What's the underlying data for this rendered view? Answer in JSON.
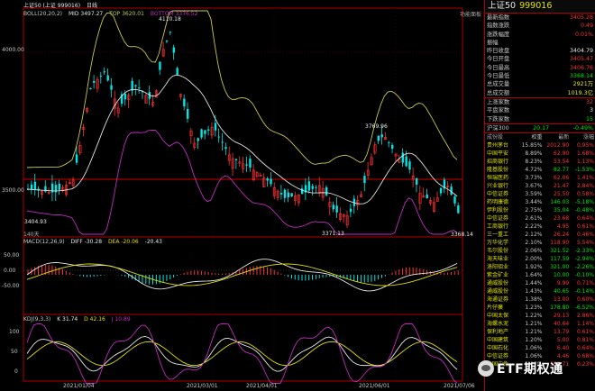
{
  "top_panel": {
    "title": "上证50 (上证 999016)",
    "period": "日线",
    "indicator_name": "BOLL(20,20,2)",
    "mid": "MID 3497.27",
    "top": "TOP 3620.01",
    "bottom": "BOTTOM 3376.52",
    "corner_label": "功能面板"
  },
  "price_labels": {
    "high1": "4110.18",
    "high2": "3769.96",
    "low1": "3404.93",
    "low2": "3371.13",
    "low3": "3368.14",
    "axis_4000": "4000.00",
    "axis_3500": "3500.00",
    "bars_label": "140天"
  },
  "macd_panel": {
    "name": "MACD(12,26,9)",
    "diff": "DIFF -30.28",
    "dea": "DEA -20.06",
    "macd": "-20.43",
    "axis_50": "50.00",
    "axis_0": "0.00",
    "axis_m50": "-50.00"
  },
  "kdj_panel": {
    "name": "KDJ(9,3,3)",
    "k": "K 31.74",
    "d": "D 42.16",
    "j": "J 10.89",
    "axis_100": "100",
    "axis_50": "50",
    "axis_0": "0"
  },
  "dates": [
    "2021/01/04",
    "2021/03/01",
    "2021/04/01",
    "2021/06/01",
    "2021/07/06"
  ],
  "quote": {
    "name": "上证50",
    "code": "999016",
    "rows": [
      {
        "label": "最新指数",
        "value": "3405.28",
        "color": "red"
      },
      {
        "label": "指数涨跌",
        "value": "0.49",
        "color": "red"
      },
      {
        "label": "涨跌幅度",
        "value": "0.01%",
        "color": "red"
      },
      {
        "label": "振幅",
        "value": "",
        "color": "white"
      },
      {
        "label": "昨日收盘",
        "value": "3404.79",
        "color": "white"
      },
      {
        "label": "今日开盘",
        "value": "3405.47",
        "color": "red"
      },
      {
        "label": "今日最高",
        "value": "3406.76",
        "color": "red"
      },
      {
        "label": "今日最低",
        "value": "3368.14",
        "color": "green"
      },
      {
        "label": "总成交量",
        "value": "2921万",
        "color": "yellow"
      },
      {
        "label": "总成交额",
        "value": "1019.3亿",
        "color": "yellow"
      },
      {
        "label": "上涨家数",
        "value": "32",
        "color": "red"
      },
      {
        "label": "平盘家数",
        "value": "3",
        "color": "white"
      },
      {
        "label": "下跌家数",
        "value": "15",
        "color": "green"
      },
      {
        "label": "沪深300",
        "value": "20.17",
        "value2": "-0.49%",
        "color": "green"
      }
    ]
  },
  "components": {
    "headers": [
      "成份股",
      "权重",
      "最新",
      "涨幅"
    ],
    "rows": [
      {
        "name": "贵州茅台",
        "w": "15.85%",
        "p": "2012.90",
        "c": "0.95%",
        "dir": "up"
      },
      {
        "name": "中国平安",
        "w": "8.89%",
        "p": "62.90",
        "c": "1.68%",
        "dir": "up"
      },
      {
        "name": "招商银行",
        "w": "8.23%",
        "p": "53.54",
        "c": "1.13%",
        "dir": "up"
      },
      {
        "name": "隆基股份",
        "w": "4.72%",
        "p": "82.77",
        "c": "-1.53%",
        "dir": "down"
      },
      {
        "name": "恒瑞医药",
        "w": "3.73%",
        "p": "62.06",
        "c": "1.41%",
        "dir": "up"
      },
      {
        "name": "兴业银行",
        "w": "3.67%",
        "p": "21.47",
        "c": "2.84%",
        "dir": "up"
      },
      {
        "name": "中信证券",
        "w": "3.59%",
        "p": "25.50",
        "c": "0.58%",
        "dir": "up"
      },
      {
        "name": "药明康德",
        "w": "3.44%",
        "p": "146.03",
        "c": "-5.18%",
        "dir": "down"
      },
      {
        "name": "伊利股份",
        "w": "2.75%",
        "p": "35.04",
        "c": "-0.48%",
        "dir": "down"
      },
      {
        "name": "中信证券",
        "w": "2.61%",
        "p": "23.68",
        "c": "0.64%",
        "dir": "up"
      },
      {
        "name": "工商银行",
        "w": "2.22%",
        "p": "4.95",
        "c": "0.61%",
        "dir": "up"
      },
      {
        "name": "三一重工",
        "w": "2.12%",
        "p": "26.24",
        "c": "0.46%",
        "dir": "up"
      },
      {
        "name": "万华化学",
        "w": "2.10%",
        "p": "118.90",
        "c": "5.54%",
        "dir": "up"
      },
      {
        "name": "韦尔股份",
        "w": "2.06%",
        "p": "321.52",
        "c": "-2.33%",
        "dir": "down"
      },
      {
        "name": "海天味业",
        "w": "2.00%",
        "p": "117.59",
        "c": "-2.94%",
        "dir": "down"
      },
      {
        "name": "洛阳钼业",
        "w": "1.92%",
        "p": "321.00",
        "c": "-2.26%",
        "dir": "down"
      },
      {
        "name": "紫金矿业",
        "w": "1.64%",
        "p": "10.00",
        "c": "-0.10%",
        "dir": "down"
      },
      {
        "name": "通威股份",
        "w": "1.44%",
        "p": "9.99",
        "c": "0.71%",
        "dir": "up"
      },
      {
        "name": "通威股份",
        "w": "1.43%",
        "p": "40.65",
        "c": "-0.14%",
        "dir": "down"
      },
      {
        "name": "海通证券",
        "w": "1.38%",
        "p": "13.00",
        "c": "0.60%",
        "dir": "up"
      },
      {
        "name": "片仔癀",
        "w": "1.23%",
        "p": "178.80",
        "c": "-6.52%",
        "dir": "down"
      },
      {
        "name": "中国太保",
        "w": "1.22%",
        "p": "29.13",
        "c": "2.86%",
        "dir": "up"
      },
      {
        "name": "海螺水泥",
        "w": "1.21%",
        "p": "40.64",
        "c": "1.14%",
        "dir": "up"
      },
      {
        "name": "保利地产",
        "w": "1.21%",
        "p": "13.79",
        "c": "0.61%",
        "dir": "up"
      },
      {
        "name": "中国建筑",
        "w": "1.20%",
        "p": "5.00",
        "c": "0.81%",
        "dir": "up"
      },
      {
        "name": "中国石化",
        "w": "1.06%",
        "p": "6.40",
        "c": "0.64%",
        "dir": "up"
      },
      {
        "name": "中信证券",
        "w": "1.06%",
        "p": "4.46",
        "c": "0.68%",
        "dir": "up"
      },
      {
        "name": "中国中免",
        "w": "1.07%",
        "p": "257.71",
        "c": "0.23%",
        "dir": "up"
      }
    ]
  },
  "watermark": {
    "text": "ETF期权通"
  },
  "colors": {
    "up": "#ff3232",
    "down": "#00e6e6",
    "mid": "#e0e0e0",
    "upper": "#c8c84a",
    "lower": "#c02cc0",
    "bg": "#000000",
    "grid": "#b00000"
  }
}
